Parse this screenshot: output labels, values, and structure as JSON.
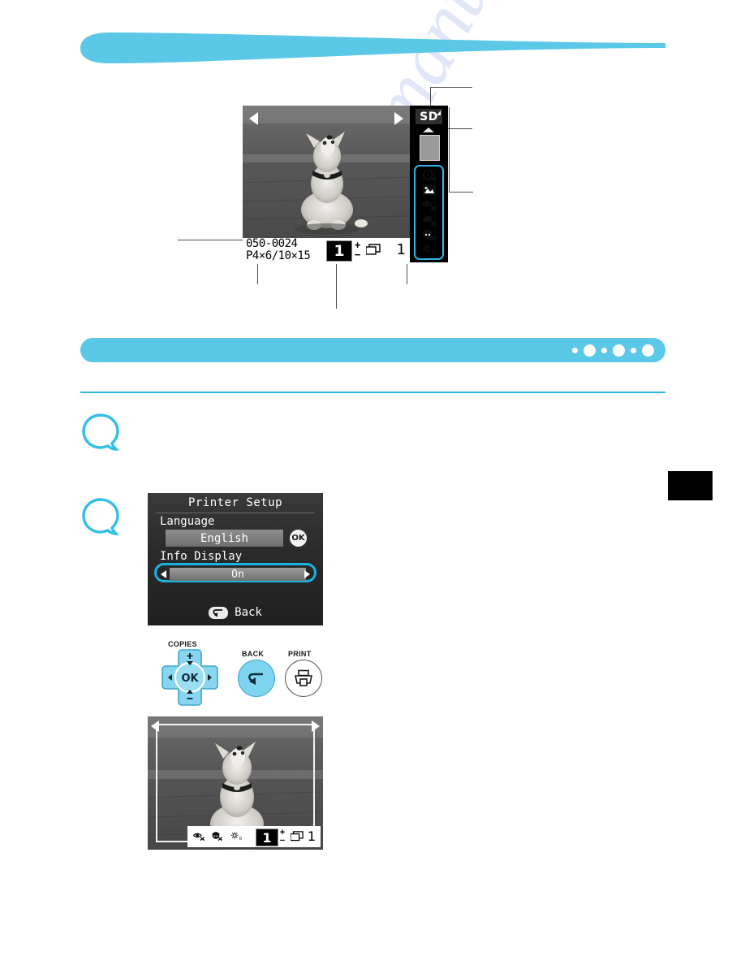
{
  "colors": {
    "accent_cyan": "#5bc8e8",
    "accent_cyan_dark": "#2eb8e6",
    "lcd_black": "#000000",
    "panel_gray": "#9a9a9a"
  },
  "top_screen": {
    "nav_left_icon": "triangle-left-icon",
    "nav_right_icon": "triangle-right-icon",
    "file_number": "050-0024",
    "paper_size": "P4×6/10×15",
    "copies_value": "1",
    "increase_symbol": "+",
    "decrease_symbol": "−",
    "stack_icon": "stacked-sheets-icon",
    "total_prints": "1",
    "side_panel": {
      "card_label": "SD",
      "eject_icon": "eject-marker-icon",
      "card_graphic": "memory-card-icon",
      "status_icons": [
        {
          "name": "date-off-icon",
          "glyph": "clock-with-x"
        },
        {
          "name": "image-optimize-icon",
          "glyph": "picture"
        },
        {
          "name": "red-eye-correction-off-icon",
          "glyph": "eye-with-x"
        },
        {
          "name": "noise-reduction-off-icon",
          "glyph": "blob-with-x"
        },
        {
          "name": "face-brightener-off-icon",
          "glyph": "face-with-x"
        },
        {
          "name": "brightness-level-icon",
          "glyph": "sun",
          "value": "0"
        }
      ]
    }
  },
  "band": {
    "dots": [
      "small",
      "large",
      "small",
      "large",
      "small",
      "large"
    ]
  },
  "steps": [
    {
      "name": "step-bubble-1",
      "label": ""
    },
    {
      "name": "step-bubble-2",
      "label": ""
    }
  ],
  "printer_setup": {
    "title": "Printer Setup",
    "language_label": "Language",
    "language_value": "English",
    "ok_label": "OK",
    "info_display_label": "Info Display",
    "info_display_value": "On",
    "left_arrow_icon": "triangle-left-icon",
    "right_arrow_icon": "triangle-right-icon",
    "back_label": "Back",
    "back_icon": "return-arrow-icon"
  },
  "buttons": {
    "copies_label": "COPIES",
    "ok_label": "OK",
    "up_icon": "plus-up-icon",
    "down_icon": "minus-down-icon",
    "left_icon": "triangle-left-icon",
    "right_icon": "triangle-right-icon",
    "back_label": "BACK",
    "back_icon": "return-arrow-icon",
    "print_label": "PRINT",
    "print_icon": "printer-icon"
  },
  "bottom_screen": {
    "nav_left_icon": "triangle-left-icon",
    "nav_right_icon": "triangle-right-icon",
    "status_icons": [
      {
        "name": "red-eye-correction-off-icon",
        "glyph": "eye-with-x"
      },
      {
        "name": "face-brightener-off-icon",
        "glyph": "face-with-x"
      },
      {
        "name": "brightness-level-icon",
        "glyph": "sun",
        "value": "0"
      }
    ],
    "copies_value": "1",
    "increase_symbol": "+",
    "decrease_symbol": "−",
    "stack_icon": "stacked-sheets-icon",
    "total_prints": "1"
  },
  "watermark": {
    "text": "manualshive.com"
  }
}
